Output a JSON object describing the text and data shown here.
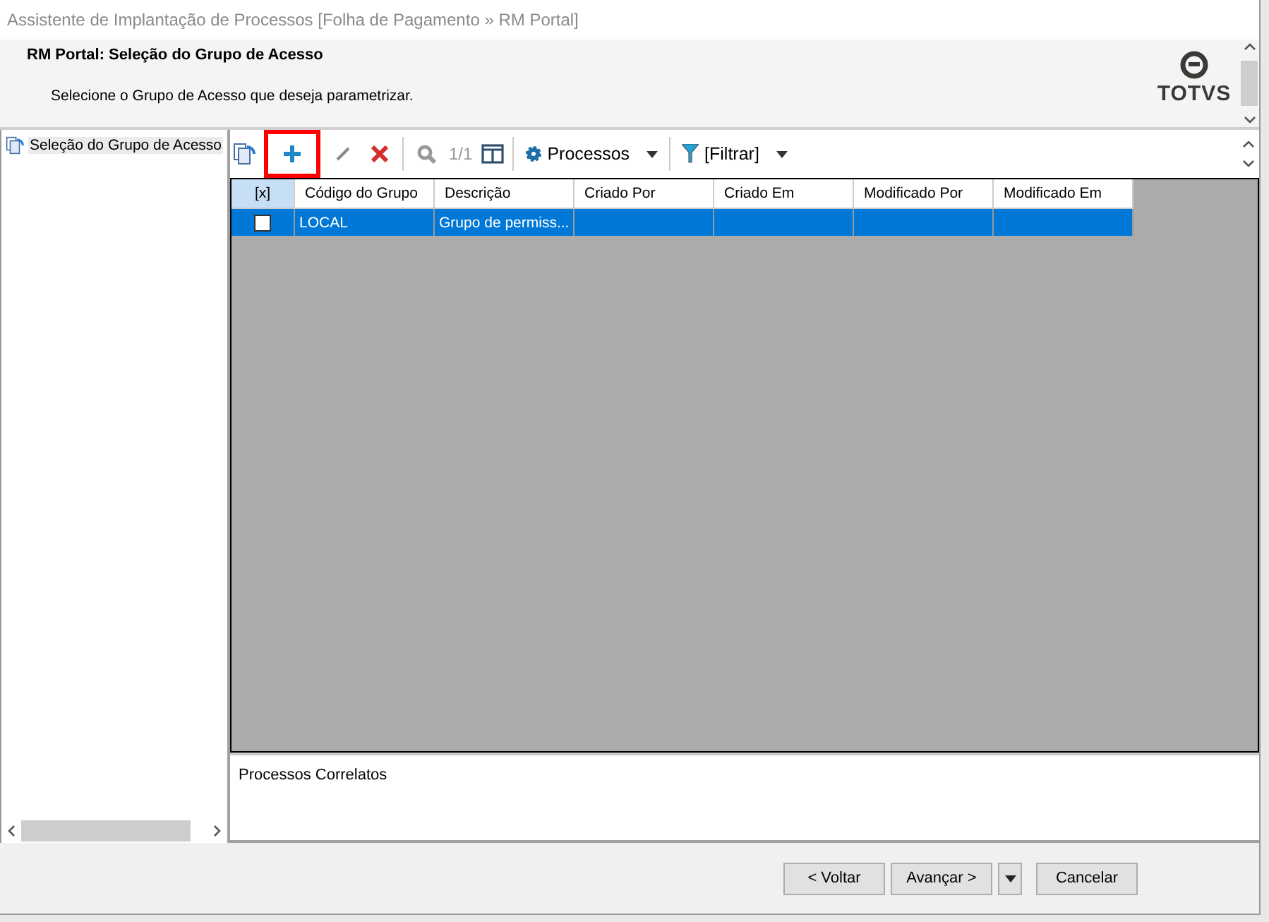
{
  "window": {
    "title": "Assistente de Implantação de Processos [Folha de Pagamento » RM Portal]"
  },
  "header": {
    "title": "RM Portal: Seleção do Grupo de Acesso",
    "subtitle": "Selecione o Grupo de Acesso que deseja parametrizar.",
    "logo_text": "TOTVS"
  },
  "sidebar": {
    "items": [
      {
        "label": "Seleção do Grupo de Acesso",
        "selected": true
      }
    ]
  },
  "toolbar": {
    "items": [
      {
        "kind": "refresh"
      },
      {
        "kind": "add",
        "highlighted": true
      },
      {
        "kind": "edit",
        "highlighted": false
      },
      {
        "kind": "delete",
        "highlighted": false
      },
      {
        "kind": "search",
        "highlighted": false
      },
      {
        "kind": "counter",
        "label": "1/1"
      },
      {
        "kind": "columns"
      },
      {
        "kind": "process_menu",
        "label": "Processos"
      },
      {
        "kind": "filter_menu",
        "label": "[Filtrar]"
      }
    ]
  },
  "table": {
    "columns": [
      "[x]",
      "Código do Grupo",
      "Descrição",
      "Criado Por",
      "Criado Em",
      "Modificado Por",
      "Modificado Em"
    ],
    "rows": [
      {
        "checked": false,
        "selected": true,
        "cells": [
          "",
          "LOCAL",
          "Grupo de permiss...",
          "",
          "",
          "",
          ""
        ]
      }
    ]
  },
  "related": {
    "title": "Processos Correlatos"
  },
  "buttons": [
    {
      "label": "< Voltar",
      "kind": "button"
    },
    {
      "label": "Avançar >",
      "kind": "button"
    },
    {
      "kind": "dropdown"
    },
    {
      "label": "Cancelar",
      "kind": "button"
    }
  ]
}
